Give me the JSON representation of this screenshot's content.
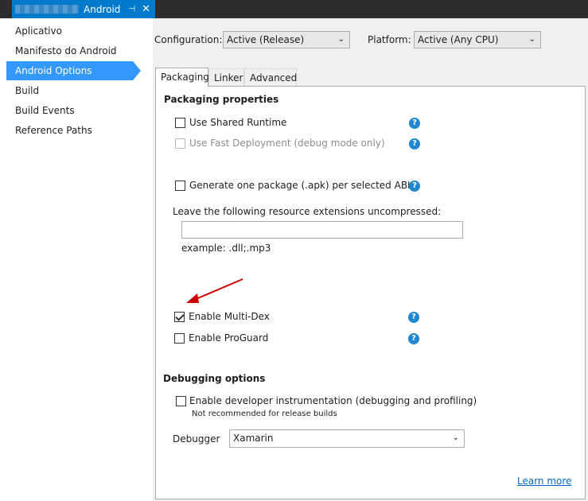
{
  "titlebar": {
    "tab_title": "Android"
  },
  "sidebar": {
    "items": [
      {
        "label": "Aplicativo"
      },
      {
        "label": "Manifesto do Android"
      },
      {
        "label": "Android Options"
      },
      {
        "label": "Build"
      },
      {
        "label": "Build Events"
      },
      {
        "label": "Reference Paths"
      }
    ],
    "active_index": 2
  },
  "config": {
    "configuration_label": "Configuration:",
    "configuration_value": "Active (Release)",
    "platform_label": "Platform:",
    "platform_value": "Active (Any CPU)"
  },
  "tabs": [
    {
      "label": "Packaging"
    },
    {
      "label": "Linker"
    },
    {
      "label": "Advanced"
    }
  ],
  "packaging": {
    "title": "Packaging properties",
    "use_shared_runtime": {
      "label": "Use Shared Runtime",
      "checked": false
    },
    "use_fast_deployment": {
      "label": "Use Fast Deployment (debug mode only)",
      "checked": false,
      "disabled": true
    },
    "one_package_per_abi": {
      "label": "Generate one package (.apk) per selected ABI",
      "checked": false
    },
    "uncompressed_label": "Leave the following resource extensions uncompressed:",
    "uncompressed_value": "",
    "uncompressed_example": "example: .dll;.mp3",
    "multidex": {
      "label": "Enable Multi-Dex",
      "checked": true
    },
    "proguard": {
      "label": "Enable ProGuard",
      "checked": false
    }
  },
  "debugging": {
    "title": "Debugging options",
    "instrumentation": {
      "label": "Enable developer instrumentation (debugging and profiling)",
      "checked": false
    },
    "instrumentation_note": "Not recommended for release builds",
    "debugger_label": "Debugger",
    "debugger_value": "Xamarin"
  },
  "learn_more": "Learn more",
  "colors": {
    "accent": "#3399ff",
    "titlebar": "#2d2d30",
    "doc_tab": "#007acc",
    "help": "#1e88d2",
    "annotation_arrow": "#cc0000"
  }
}
